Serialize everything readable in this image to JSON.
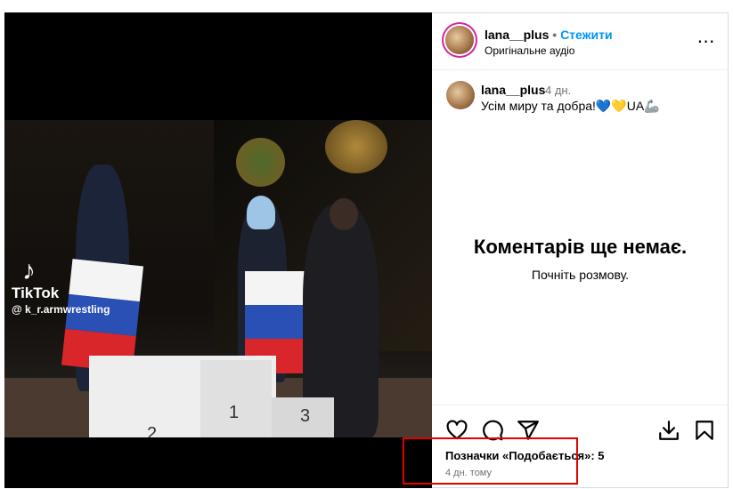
{
  "video": {
    "watermark_brand": "TikTok",
    "watermark_handle": "@ k_r.armwrestling",
    "podium_numbers": [
      "2",
      "1",
      "3"
    ]
  },
  "post": {
    "author": "lana__plus",
    "separator": "•",
    "follow_label": "Стежити",
    "audio_label": "Оригінальне аудіо",
    "more_icon": "⋯",
    "caption_author": "lana__plus",
    "caption_time": "4 дн.",
    "caption_text": "Усім миру та добра!💙💛UA🦾"
  },
  "comments": {
    "empty_title": "Коментарів ще немає.",
    "empty_subtitle": "Почніть розмову."
  },
  "footer": {
    "likes_text": "Позначки «Подобається»: 5",
    "posted_ago": "4 дн. тому"
  },
  "icons": [
    "heart-icon",
    "comment-icon",
    "share-icon",
    "download-icon",
    "bookmark-icon"
  ],
  "colors": {
    "accent": "#0095f6",
    "highlight_box": "#e00000"
  }
}
